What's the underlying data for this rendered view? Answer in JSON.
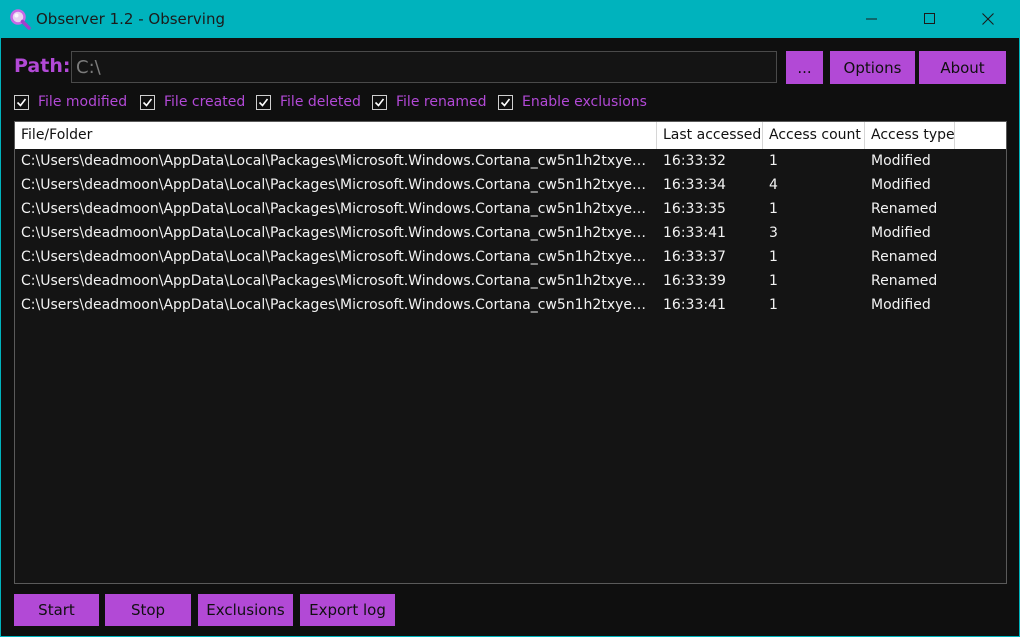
{
  "window": {
    "title": "Observer 1.2 - Observing",
    "icon": "magnifier-icon",
    "controls": [
      "minimize-icon",
      "maximize-icon",
      "close-icon"
    ]
  },
  "colors": {
    "titlebar": "#00b3bd",
    "accent": "#b249d6",
    "background": "#0f0f0f",
    "text": "#f2f2f2"
  },
  "path": {
    "label": "Path:",
    "value": "C:\\",
    "browse_label": "...",
    "options_label": "Options",
    "about_label": "About"
  },
  "filters": [
    {
      "label": "File modified",
      "checked": true
    },
    {
      "label": "File created",
      "checked": true
    },
    {
      "label": "File deleted",
      "checked": true
    },
    {
      "label": "File renamed",
      "checked": true
    },
    {
      "label": "Enable exclusions",
      "checked": true
    }
  ],
  "table": {
    "columns": [
      "File/Folder",
      "Last accessed",
      "Access count",
      "Access type"
    ],
    "rows": [
      {
        "path": "C:\\Users\\deadmoon\\AppData\\Local\\Packages\\Microsoft.Windows.Cortana_cw5n1h2txyewy...",
        "time": "16:33:32",
        "count": "1",
        "type": "Modified"
      },
      {
        "path": "C:\\Users\\deadmoon\\AppData\\Local\\Packages\\Microsoft.Windows.Cortana_cw5n1h2txyewy...",
        "time": "16:33:34",
        "count": "4",
        "type": "Modified"
      },
      {
        "path": "C:\\Users\\deadmoon\\AppData\\Local\\Packages\\Microsoft.Windows.Cortana_cw5n1h2txyewy...",
        "time": "16:33:35",
        "count": "1",
        "type": "Renamed"
      },
      {
        "path": "C:\\Users\\deadmoon\\AppData\\Local\\Packages\\Microsoft.Windows.Cortana_cw5n1h2txyewy...",
        "time": "16:33:41",
        "count": "3",
        "type": "Modified"
      },
      {
        "path": "C:\\Users\\deadmoon\\AppData\\Local\\Packages\\Microsoft.Windows.Cortana_cw5n1h2txyewy...",
        "time": "16:33:37",
        "count": "1",
        "type": "Renamed"
      },
      {
        "path": "C:\\Users\\deadmoon\\AppData\\Local\\Packages\\Microsoft.Windows.Cortana_cw5n1h2txyewy...",
        "time": "16:33:39",
        "count": "1",
        "type": "Renamed"
      },
      {
        "path": "C:\\Users\\deadmoon\\AppData\\Local\\Packages\\Microsoft.Windows.Cortana_cw5n1h2txyewy...",
        "time": "16:33:41",
        "count": "1",
        "type": "Modified"
      }
    ]
  },
  "actions": {
    "start_label": "Start",
    "stop_label": "Stop",
    "exclusions_label": "Exclusions",
    "export_label": "Export log"
  }
}
